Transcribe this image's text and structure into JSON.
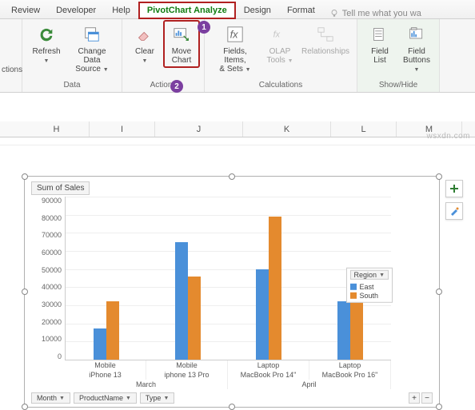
{
  "tabs": {
    "review": "Review",
    "developer": "Developer",
    "help": "Help",
    "analyze": "PivotChart Analyze",
    "design": "Design",
    "format": "Format",
    "tell_me": "Tell me what you wa"
  },
  "ribbon": {
    "options_stub": "ctions",
    "data": {
      "refresh": "Refresh",
      "change_data": "Change Data\nSource",
      "group": "Data"
    },
    "actions": {
      "clear": "Clear",
      "move": "Move\nChart",
      "group": "Actions"
    },
    "calc": {
      "fields": "Fields, Items,\n& Sets",
      "olap": "OLAP\nTools",
      "rel": "Relationships",
      "group": "Calculations"
    },
    "show": {
      "flist": "Field\nList",
      "fbtn": "Field\nButtons",
      "group": "Show/Hide"
    }
  },
  "columns": [
    "H",
    "I",
    "J",
    "K",
    "L",
    "M"
  ],
  "chart_data": {
    "type": "bar",
    "title": "Sum of Sales",
    "ylabel": "",
    "xlabel": "",
    "ylim": [
      0,
      90000
    ],
    "yticks": [
      0,
      10000,
      20000,
      30000,
      40000,
      50000,
      60000,
      70000,
      80000,
      90000
    ],
    "categories_level1": [
      "Mobile",
      "Mobile",
      "Laptop",
      "Laptop"
    ],
    "categories_level2": [
      "iPhone 13",
      "iphone 13 Pro",
      "MacBook Pro 14\"",
      "MacBook Pro 16\""
    ],
    "categories_level3": [
      "March",
      "April"
    ],
    "series": [
      {
        "name": "East",
        "values": [
          17000,
          65000,
          50000,
          32000
        ]
      },
      {
        "name": "South",
        "values": [
          32000,
          46000,
          79000,
          40000
        ]
      }
    ],
    "legend_title": "Region"
  },
  "pivot_filters": {
    "month": "Month",
    "product": "ProductName",
    "type": "Type"
  },
  "badges": {
    "p1": "1",
    "p2": "2"
  },
  "watermark": "wsxdn.com"
}
